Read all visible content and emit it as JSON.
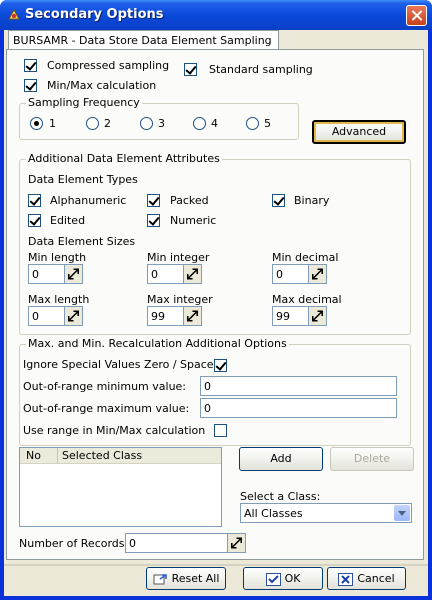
{
  "window": {
    "title": "Secondary Options"
  },
  "tab": {
    "label": "BURSAMR - Data Store Data Element Sampling"
  },
  "options": {
    "compressed_sampling": {
      "label": "Compressed sampling",
      "checked": true
    },
    "standard_sampling": {
      "label": "Standard sampling",
      "checked": true
    },
    "minmax_calc": {
      "label": "Min/Max calculation",
      "checked": true
    }
  },
  "sampling_frequency": {
    "title": "Sampling Frequency",
    "options": [
      "1",
      "2",
      "3",
      "4",
      "5"
    ],
    "selected": "1",
    "advanced_label": "Advanced"
  },
  "attributes": {
    "title": "Additional Data Element Attributes",
    "types_title": "Data Element Types",
    "types": [
      {
        "label": "Alphanumeric",
        "checked": true
      },
      {
        "label": "Packed",
        "checked": true
      },
      {
        "label": "Binary",
        "checked": true
      },
      {
        "label": "Edited",
        "checked": true
      },
      {
        "label": "Numeric",
        "checked": true
      }
    ],
    "sizes_title": "Data Element Sizes",
    "sizes": [
      {
        "label": "Min length",
        "value": "0"
      },
      {
        "label": "Min integer",
        "value": "0"
      },
      {
        "label": "Min decimal",
        "value": "0"
      },
      {
        "label": "Max length",
        "value": "0"
      },
      {
        "label": "Max integer",
        "value": "99"
      },
      {
        "label": "Max decimal",
        "value": "99"
      }
    ]
  },
  "recalc": {
    "title": "Max. and Min. Recalculation Additional Options",
    "ignore_label": "Ignore Special Values Zero / Space",
    "ignore_checked": true,
    "min_label": "Out-of-range minimum value:",
    "min_value": "0",
    "max_label": "Out-of-range maximum value:",
    "max_value": "0",
    "use_range_label": "Use range in Min/Max calculation",
    "use_range_checked": false
  },
  "class_list": {
    "col_no": "No",
    "col_selected": "Selected Class"
  },
  "add_label": "Add",
  "delete_label": "Delete",
  "select_class": {
    "label": "Select a Class:",
    "value": "All Classes"
  },
  "records": {
    "label": "Number of Records:",
    "value": "0"
  },
  "footer": {
    "reset_label": "Reset All",
    "ok_label": "OK",
    "cancel_label": "Cancel"
  }
}
